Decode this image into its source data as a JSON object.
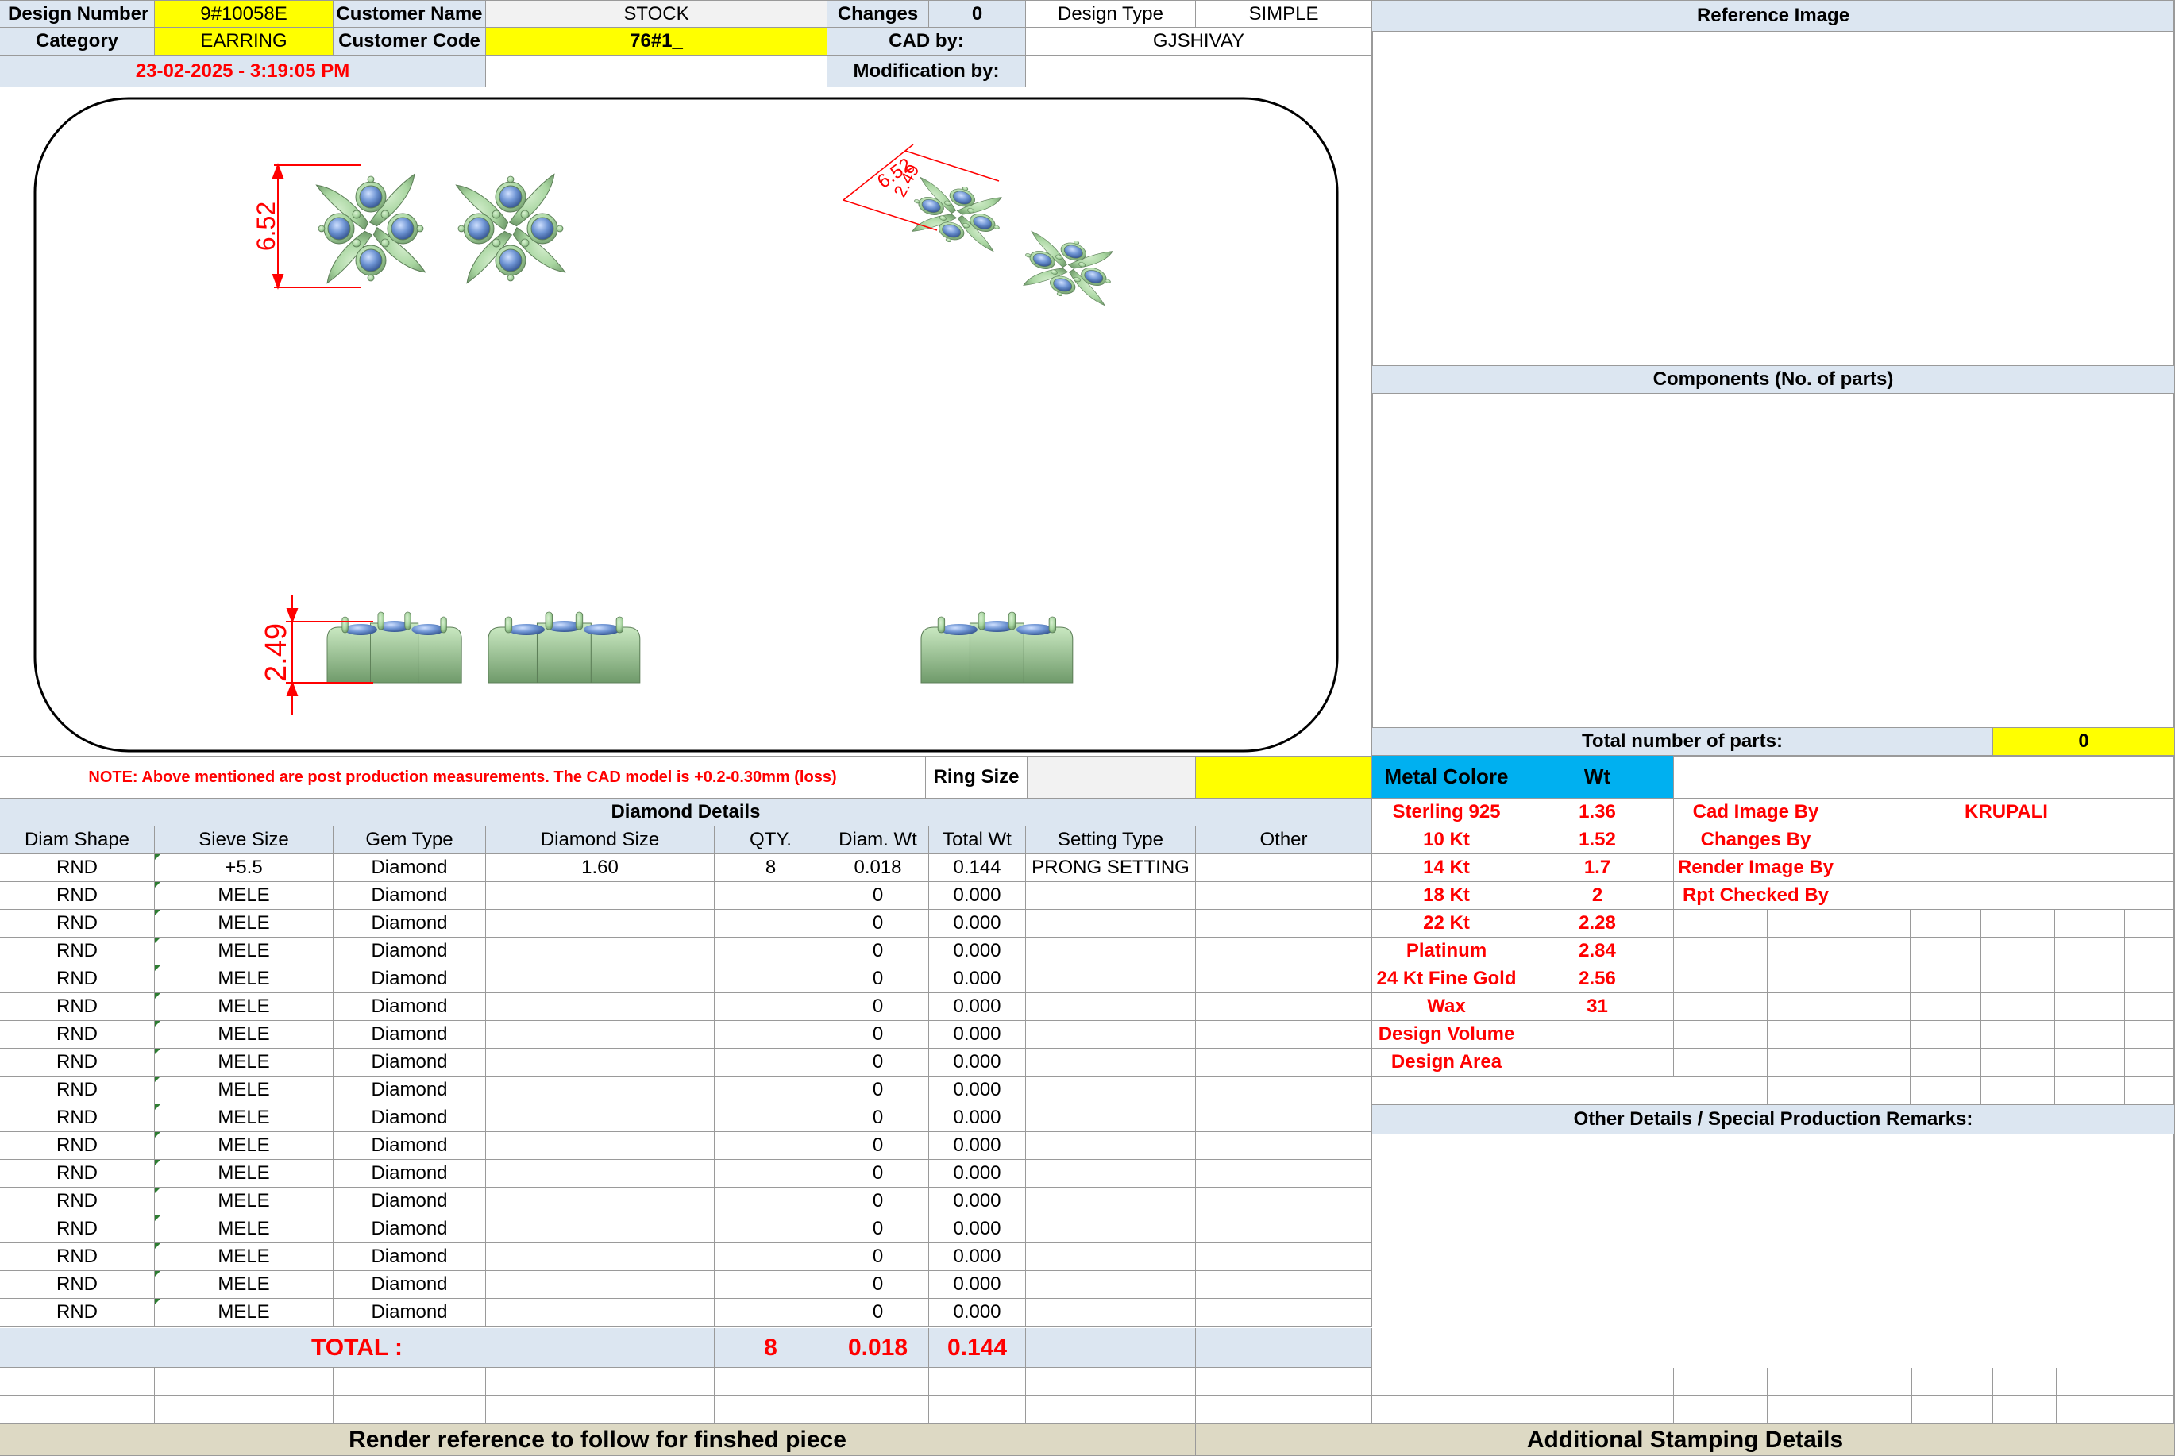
{
  "header": {
    "design_number_label": "Design Number",
    "design_number": "9#10058E",
    "customer_name_label": "Customer Name",
    "customer_name": "STOCK",
    "changes_label": "Changes",
    "changes": "0",
    "design_type_label": "Design Type",
    "design_type": "SIMPLE",
    "reference_image_label": "Reference Image",
    "category_label": "Category",
    "category": "EARRING",
    "customer_code_label": "Customer Code",
    "customer_code": "76#1_",
    "cad_by_label": "CAD by:",
    "cad_by": "GJSHIVAY",
    "timestamp": "23-02-2025 - 3:19:05 PM",
    "modification_by_label": "Modification by:"
  },
  "drawing": {
    "top_width": "6.52",
    "side_height": "2.49",
    "persp_a": "6.52",
    "persp_b": "2.49"
  },
  "note": "NOTE: Above mentioned are post production measurements. The CAD model is +0.2-0.30mm (loss)",
  "ring_size_label": "Ring Size",
  "components_label": "Components (No. of parts)",
  "total_parts_label": "Total number of parts:",
  "total_parts": "0",
  "diamond": {
    "title": "Diamond Details",
    "headers": [
      "Diam Shape",
      "Sieve Size",
      "Gem Type",
      "Diamond Size",
      "QTY.",
      "Diam. Wt",
      "Total Wt",
      "Setting Type",
      "Other"
    ],
    "rows": [
      [
        "RND",
        "+5.5",
        "Diamond",
        "1.60",
        "8",
        "0.018",
        "0.144",
        "PRONG SETTING",
        ""
      ],
      [
        "RND",
        "MELE",
        "Diamond",
        "",
        "",
        "0",
        "0.000",
        "",
        ""
      ],
      [
        "RND",
        "MELE",
        "Diamond",
        "",
        "",
        "0",
        "0.000",
        "",
        ""
      ],
      [
        "RND",
        "MELE",
        "Diamond",
        "",
        "",
        "0",
        "0.000",
        "",
        ""
      ],
      [
        "RND",
        "MELE",
        "Diamond",
        "",
        "",
        "0",
        "0.000",
        "",
        ""
      ],
      [
        "RND",
        "MELE",
        "Diamond",
        "",
        "",
        "0",
        "0.000",
        "",
        ""
      ],
      [
        "RND",
        "MELE",
        "Diamond",
        "",
        "",
        "0",
        "0.000",
        "",
        ""
      ],
      [
        "RND",
        "MELE",
        "Diamond",
        "",
        "",
        "0",
        "0.000",
        "",
        ""
      ],
      [
        "RND",
        "MELE",
        "Diamond",
        "",
        "",
        "0",
        "0.000",
        "",
        ""
      ],
      [
        "RND",
        "MELE",
        "Diamond",
        "",
        "",
        "0",
        "0.000",
        "",
        ""
      ],
      [
        "RND",
        "MELE",
        "Diamond",
        "",
        "",
        "0",
        "0.000",
        "",
        ""
      ],
      [
        "RND",
        "MELE",
        "Diamond",
        "",
        "",
        "0",
        "0.000",
        "",
        ""
      ],
      [
        "RND",
        "MELE",
        "Diamond",
        "",
        "",
        "0",
        "0.000",
        "",
        ""
      ],
      [
        "RND",
        "MELE",
        "Diamond",
        "",
        "",
        "0",
        "0.000",
        "",
        ""
      ],
      [
        "RND",
        "MELE",
        "Diamond",
        "",
        "",
        "0",
        "0.000",
        "",
        ""
      ],
      [
        "RND",
        "MELE",
        "Diamond",
        "",
        "",
        "0",
        "0.000",
        "",
        ""
      ],
      [
        "RND",
        "MELE",
        "Diamond",
        "",
        "",
        "0",
        "0.000",
        "",
        ""
      ]
    ],
    "total_label": "TOTAL :",
    "total_qty": "8",
    "total_diam_wt": "0.018",
    "total_wt": "0.144"
  },
  "metal": {
    "color_label": "Metal Colore",
    "wt_label": "Wt",
    "rows": [
      [
        "Sterling 925",
        "1.36"
      ],
      [
        "10 Kt",
        "1.52"
      ],
      [
        "14 Kt",
        "1.7"
      ],
      [
        "18 Kt",
        "2"
      ],
      [
        "22 Kt",
        "2.28"
      ],
      [
        "Platinum",
        "2.84"
      ],
      [
        "24 Kt Fine Gold",
        "2.56"
      ],
      [
        "Wax",
        "31"
      ],
      [
        "Design Volume",
        ""
      ],
      [
        "Design Area",
        ""
      ]
    ]
  },
  "credits": {
    "cad_image_by_label": "Cad Image By",
    "cad_image_by": "KRUPALI",
    "changes_by_label": "Changes By",
    "render_image_by_label": "Render Image By",
    "rpt_checked_by_label": "Rpt Checked By"
  },
  "other_details_label": "Other Details / Special Production Remarks:",
  "footer": {
    "render_reference": "Render reference to follow for finshed piece",
    "stamping": "Additional Stamping Details"
  },
  "colors": {
    "header_blue": "#dce6f1",
    "highlight_yellow": "#ffff00",
    "metal_header_blue": "#00b0f0",
    "footer_tan": "#ddd9c4",
    "label_red": "#ff0000",
    "metal_green": "#a9d6a1",
    "stone_blue": "#6f95d4"
  }
}
